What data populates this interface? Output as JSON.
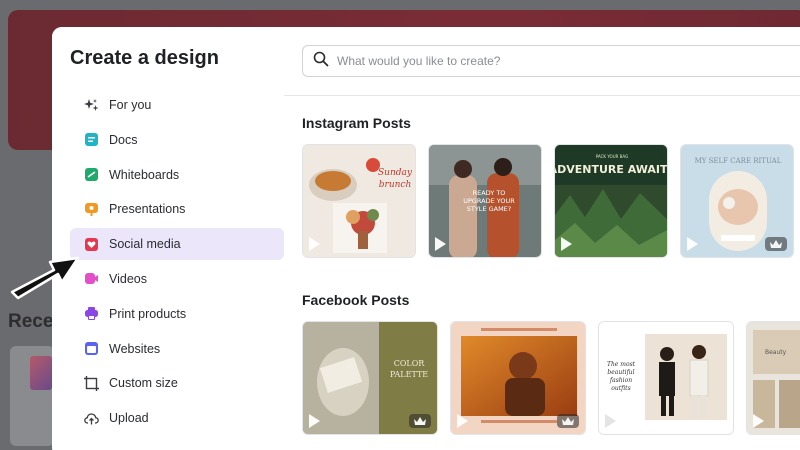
{
  "background": {
    "recent_label": "Rece"
  },
  "modal": {
    "title": "Create a design",
    "sidebar": {
      "items": [
        {
          "label": "For you",
          "icon": "sparkle-icon",
          "color": "#3b3d42"
        },
        {
          "label": "Docs",
          "icon": "doc-icon",
          "color": "#1fb5c9"
        },
        {
          "label": "Whiteboards",
          "icon": "whiteboard-icon",
          "color": "#1daa6b"
        },
        {
          "label": "Presentations",
          "icon": "presentation-icon",
          "color": "#f29a1f"
        },
        {
          "label": "Social media",
          "icon": "heart-icon",
          "color": "#e5384f"
        },
        {
          "label": "Videos",
          "icon": "video-icon",
          "color": "#e24fc9"
        },
        {
          "label": "Print products",
          "icon": "printer-icon",
          "color": "#8a47e6"
        },
        {
          "label": "Websites",
          "icon": "website-icon",
          "color": "#5b63f0"
        },
        {
          "label": "Custom size",
          "icon": "crop-icon",
          "color": "#3b3d42"
        },
        {
          "label": "Upload",
          "icon": "upload-icon",
          "color": "#3b3d42"
        }
      ],
      "active_index": 4
    },
    "search": {
      "placeholder": "What would you like to create?"
    },
    "sections": [
      {
        "title": "Instagram Posts",
        "tiles": [
          {
            "name": "food-flatlay",
            "text": "",
            "premium": false
          },
          {
            "name": "upgrade-style-game",
            "text": "READY TO UPGRADE YOUR STYLE GAME?",
            "premium": false
          },
          {
            "name": "adventure-awaits",
            "text": "ADVENTURE AWAITS",
            "premium": false
          },
          {
            "name": "self-care-ritual",
            "text": "MY SELF CARE RITUAL",
            "premium": true
          }
        ]
      },
      {
        "title": "Facebook Posts",
        "tiles": [
          {
            "name": "color-palette",
            "text": "COLOR PALETTE",
            "premium": true
          },
          {
            "name": "orange-portrait",
            "text": "",
            "premium": true
          },
          {
            "name": "fashion-duo",
            "text": "The most beautiful fashion outfits",
            "premium": false
          },
          {
            "name": "beauty-grid",
            "text": "Beauty",
            "premium": false
          }
        ]
      }
    ]
  },
  "colors": {
    "accent_active_bg": "#ece6fb",
    "modal_bg": "#ffffff"
  }
}
